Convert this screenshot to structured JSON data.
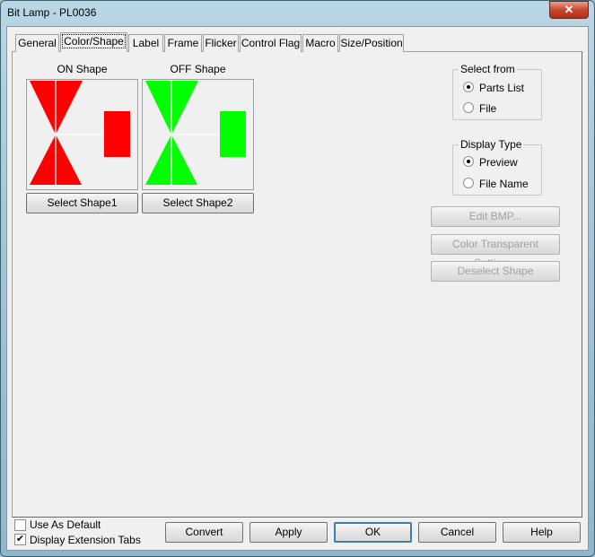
{
  "window": {
    "title": "Bit Lamp - PL0036",
    "close_icon": "close-x-icon"
  },
  "tabs": [
    {
      "label": "General"
    },
    {
      "label": "Color/Shape",
      "selected": true
    },
    {
      "label": "Label"
    },
    {
      "label": "Frame"
    },
    {
      "label": "Flicker"
    },
    {
      "label": "Control Flag"
    },
    {
      "label": "Macro"
    },
    {
      "label": "Size/Position"
    }
  ],
  "shapes": {
    "on": {
      "label": "ON Shape",
      "color": "#ff0000",
      "button": "Select Shape1"
    },
    "off": {
      "label": "OFF Shape",
      "color": "#00ff00",
      "button": "Select Shape2"
    }
  },
  "select_from": {
    "title": "Select from",
    "options": [
      {
        "label": "Parts List",
        "checked": true
      },
      {
        "label": "File",
        "checked": false
      }
    ]
  },
  "display_type": {
    "title": "Display Type",
    "options": [
      {
        "label": "Preview",
        "checked": true
      },
      {
        "label": "File Name",
        "checked": false
      }
    ]
  },
  "side_buttons": {
    "edit_bmp": "Edit BMP...",
    "color_transparent": "Color Transparent Setting...",
    "deselect": "Deselect Shape"
  },
  "footer": {
    "use_as_default": {
      "label": "Use As Default",
      "checked": false
    },
    "display_ext_tabs": {
      "label": "Display Extension Tabs",
      "checked": true
    },
    "buttons": {
      "convert": "Convert",
      "apply": "Apply",
      "ok": "OK",
      "cancel": "Cancel",
      "help": "Help"
    }
  }
}
